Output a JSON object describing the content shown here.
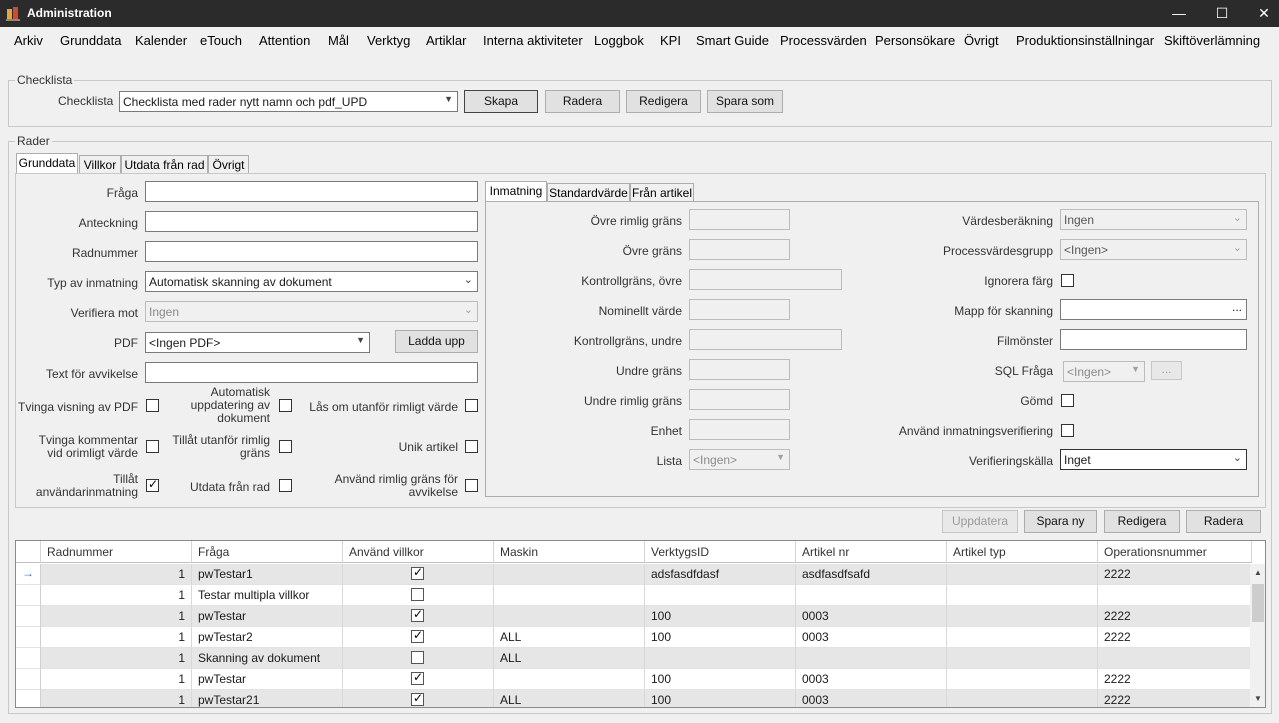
{
  "window": {
    "title": "Administration",
    "minimize": "—",
    "maximize": "☐",
    "close": "✕"
  },
  "menu": [
    "Arkiv",
    "Grunddata",
    "Kalender",
    "eTouch",
    "Attention",
    "Mål",
    "Verktyg",
    "Artiklar",
    "Interna aktiviteter",
    "Loggbok",
    "KPI",
    "Smart Guide",
    "Processvärden",
    "Personsökare",
    "Övrigt",
    "Produktionsinställningar",
    "Skiftöverlämning"
  ],
  "checklista": {
    "group_label": "Checklista",
    "field_label": "Checklista",
    "value": "Checklista med rader nytt namn och pdf_UPD",
    "buttons": {
      "create": "Skapa",
      "delete": "Radera",
      "edit": "Redigera",
      "save_as": "Spara som"
    }
  },
  "rader": {
    "group_label": "Rader",
    "tabs": [
      "Grunddata",
      "Villkor",
      "Utdata från rad",
      "Övrigt"
    ],
    "grunddata": {
      "fraga_label": "Fråga",
      "fraga_value": "",
      "anteckning_label": "Anteckning",
      "anteckning_value": "",
      "radnummer_label": "Radnummer",
      "radnummer_value": "",
      "typ_label": "Typ av inmatning",
      "typ_value": "Automatisk skanning av dokument",
      "verifiera_label": "Verifiera mot",
      "verifiera_value": "Ingen",
      "pdf_label": "PDF",
      "pdf_value": "<Ingen PDF>",
      "upload_button": "Ladda upp",
      "avvikelse_label": "Text för avvikelse",
      "avvikelse_value": "",
      "cb_tvinga_pdf": "Tvinga visning av PDF",
      "cb_auto_update_1": "Automatisk",
      "cb_auto_update_2": "uppdatering av",
      "cb_auto_update_3": "dokument",
      "cb_las": "Lås om utanför rimligt värde",
      "cb_tvinga_kommentar_1": "Tvinga kommentar",
      "cb_tvinga_kommentar_2": "vid orimligt värde",
      "cb_tillat_utanfor_1": "Tillåt utanför rimlig",
      "cb_tillat_utanfor_2": "gräns",
      "cb_unik": "Unik artikel",
      "cb_tillat_anv_1": "Tillåt",
      "cb_tillat_anv_2": "användarinmatning",
      "cb_utdata": "Utdata från rad",
      "cb_anvand_rimlig_1": "Använd rimlig gräns för",
      "cb_anvand_rimlig_2": "avvikelse"
    },
    "inner_tabs": [
      "Inmatning",
      "Standardvärde",
      "Från artikel"
    ],
    "inmatning": {
      "ovre_rimlig": "Övre rimlig gräns",
      "ovre": "Övre gräns",
      "kontroll_ovre": "Kontrollgräns, övre",
      "nominellt": "Nominellt värde",
      "kontroll_undre": "Kontrollgräns, undre",
      "undre": "Undre gräns",
      "undre_rimlig": "Undre rimlig gräns",
      "enhet": "Enhet",
      "lista": "Lista",
      "lista_value": "<Ingen>",
      "vardesberakning": "Värdesberäkning",
      "vardesberakning_value": "Ingen",
      "processvardesgrupp": "Processvärdesgrupp",
      "processvardesgrupp_value": "<Ingen>",
      "ignorera_farg": "Ignorera färg",
      "mapp": "Mapp för skanning",
      "mapp_button": "...",
      "filmonster": "Filmönster",
      "sql": "SQL Fråga",
      "sql_value": "<Ingen>",
      "sql_button": "...",
      "gomd": "Gömd",
      "anvand_verif": "Använd inmatningsverifiering",
      "verifkalla": "Verifieringskälla",
      "verifkalla_value": "Inget"
    },
    "row_buttons": {
      "update": "Uppdatera",
      "save_new": "Spara ny",
      "edit": "Redigera",
      "delete": "Radera"
    }
  },
  "grid": {
    "columns": [
      "Radnummer",
      "Fråga",
      "Använd villkor",
      "Maskin",
      "VerktygsID",
      "Artikel nr",
      "Artikel typ",
      "Operationsnummer"
    ],
    "rows": [
      {
        "radnummer": "1",
        "fraga": "pwTestar1",
        "villkor": true,
        "maskin": "",
        "verktyg": "adsfasdfdasf",
        "artikel": "asdfasdfsafd",
        "typ": "",
        "op": "2222"
      },
      {
        "radnummer": "1",
        "fraga": "Testar multipla villkor",
        "villkor": false,
        "maskin": "",
        "verktyg": "",
        "artikel": "",
        "typ": "",
        "op": ""
      },
      {
        "radnummer": "1",
        "fraga": "pwTestar",
        "villkor": true,
        "maskin": "",
        "verktyg": "100",
        "artikel": "0003",
        "typ": "",
        "op": "2222"
      },
      {
        "radnummer": "1",
        "fraga": "pwTestar2",
        "villkor": true,
        "maskin": "ALL",
        "verktyg": "100",
        "artikel": "0003",
        "typ": "",
        "op": "2222"
      },
      {
        "radnummer": "1",
        "fraga": "Skanning av dokument",
        "villkor": false,
        "maskin": "ALL",
        "verktyg": "",
        "artikel": "",
        "typ": "",
        "op": ""
      },
      {
        "radnummer": "1",
        "fraga": "pwTestar",
        "villkor": true,
        "maskin": "",
        "verktyg": "100",
        "artikel": "0003",
        "typ": "",
        "op": "2222"
      },
      {
        "radnummer": "1",
        "fraga": "pwTestar21",
        "villkor": true,
        "maskin": "ALL",
        "verktyg": "100",
        "artikel": "0003",
        "typ": "",
        "op": "2222"
      }
    ],
    "current_row_marker": "→"
  },
  "colors": {
    "titlebar": "#2b2b2b",
    "accent_arrow": "#2a6fd6",
    "alt_row": "#e6e6e6"
  }
}
